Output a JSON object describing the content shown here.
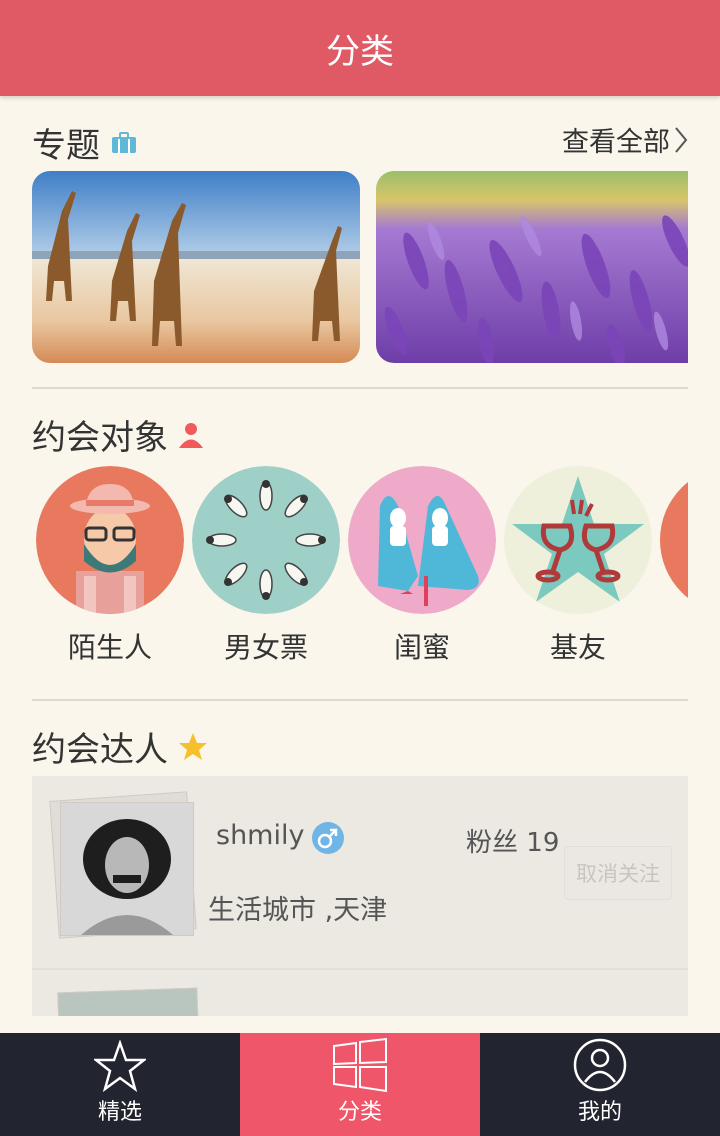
{
  "header": {
    "title": "分类"
  },
  "topics": {
    "title": "专题",
    "view_all": "查看全部"
  },
  "dates": {
    "title": "约会对象",
    "categories": [
      {
        "label": "陌生人"
      },
      {
        "label": "男女票"
      },
      {
        "label": "闺蜜"
      },
      {
        "label": "基友"
      }
    ]
  },
  "talents": {
    "title": "约会达人",
    "items": [
      {
        "name": "shmily",
        "fans_label": "粉丝",
        "fans_count": "19",
        "location": "生活城市 ,天津",
        "action": "取消关注"
      }
    ]
  },
  "tabbar": {
    "items": [
      {
        "label": "精选"
      },
      {
        "label": "分类"
      },
      {
        "label": "我的"
      }
    ]
  },
  "colors": {
    "header_bg": "#e05a66",
    "tab_active": "#f0566a",
    "tab_bg": "#222430",
    "male_badge": "#6fb6e6"
  }
}
